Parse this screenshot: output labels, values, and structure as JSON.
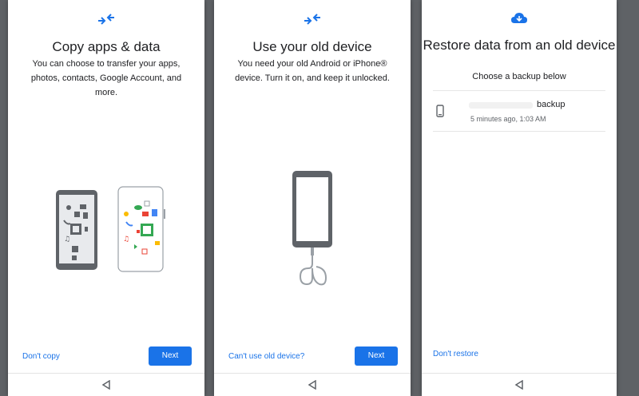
{
  "screens": [
    {
      "title": "Copy apps & data",
      "description": "You can choose to transfer your apps, photos, contacts, Google Account, and more.",
      "secondary_action": "Don't copy",
      "primary_action": "Next"
    },
    {
      "title": "Use your old device",
      "description": "You need your old Android or iPhone® device. Turn it on, and keep it unlocked.",
      "secondary_action": "Can't use old device?",
      "primary_action": "Next"
    },
    {
      "title": "Restore data from an old device",
      "subtitle": "Choose a backup below",
      "backup": {
        "name": "backup",
        "time": "5 minutes ago, 1:03 AM"
      },
      "secondary_action": "Don't restore"
    }
  ],
  "icons": {
    "transfer": "transfer-arrows-icon",
    "cloud": "cloud-download-icon",
    "back": "back-triangle-icon",
    "phone": "phone-icon"
  },
  "colors": {
    "accent": "#1a73e8",
    "background": "#5f6266",
    "device_frame": "#6b6c6f"
  }
}
